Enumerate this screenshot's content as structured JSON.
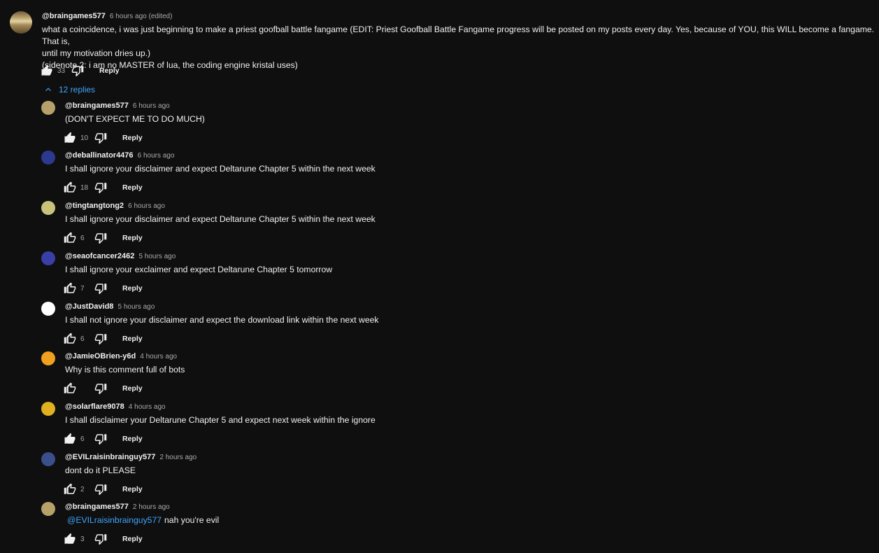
{
  "top_comment": {
    "handle": "@braingames577",
    "time": "6 hours ago (edited)",
    "lines": [
      "what a coincidence, i was just beginning to make a priest goofball battle fangame (EDIT: Priest Goofball Battle Fangame progress will be posted on my posts every day. Yes, because of YOU, this WILL become a fangame. That is,",
      "until my motivation dries up.)",
      "(sidenote 2: i am no MASTER of lua, the coding engine kristal uses)"
    ],
    "likes": "33",
    "reply_label": "Reply"
  },
  "replies_toggle": {
    "label": "12 replies"
  },
  "replies": [
    {
      "handle": "@braingames577",
      "time": "6 hours ago",
      "text": "(DON'T EXPECT ME TO DO MUCH)",
      "likes": "10",
      "reply_label": "Reply",
      "avatar_color": "#b8a06a",
      "liked": true
    },
    {
      "handle": "@deballinator4476",
      "time": "6 hours ago",
      "text": "I shall ignore your disclaimer and expect Deltarune Chapter 5 within the next week",
      "likes": "18",
      "reply_label": "Reply",
      "avatar_color": "#2b3a8f",
      "liked": false
    },
    {
      "handle": "@tingtangtong2",
      "time": "6 hours ago",
      "text": "I shall ignore your disclaimer and expect Deltarune Chapter 5 within the next week",
      "likes": "6",
      "reply_label": "Reply",
      "avatar_color": "#c9c27a",
      "liked": false
    },
    {
      "handle": "@seaofcancer2462",
      "time": "5 hours ago",
      "text": "I shall ignore your exclaimer and expect Deltarune Chapter 5 tomorrow",
      "likes": "7",
      "reply_label": "Reply",
      "avatar_color": "#3a3fa8",
      "liked": false
    },
    {
      "handle": "@JustDavid8",
      "time": "5 hours ago",
      "text": "I shall not ignore your disclaimer and expect the download link within the next week",
      "likes": "6",
      "reply_label": "Reply",
      "avatar_color": "#ffffff",
      "liked": false
    },
    {
      "handle": "@JamieOBrien-y6d",
      "time": "4 hours ago",
      "text": "Why is this comment full of bots",
      "likes": "",
      "reply_label": "Reply",
      "avatar_color": "#f0a020",
      "liked": false
    },
    {
      "handle": "@solarflare9078",
      "time": "4 hours ago",
      "text": "I shall disclaimer your Deltarune Chapter 5 and expect next week within the ignore",
      "likes": "6",
      "reply_label": "Reply",
      "avatar_color": "#e0b020",
      "liked": true
    },
    {
      "handle": "@EVILraisinbrainguy577",
      "time": "2 hours ago",
      "text": "dont do it PLEASE",
      "likes": "2",
      "reply_label": "Reply",
      "avatar_color": "#3b4f8a",
      "liked": false
    },
    {
      "handle": "@braingames577",
      "time": "2 hours ago",
      "mention": "@EVILraisinbrainguy577",
      "text": "nah you're evil",
      "likes": "3",
      "reply_label": "Reply",
      "avatar_color": "#b8a06a",
      "liked": true
    }
  ],
  "icons": {
    "like": "thumb-up-icon",
    "dislike": "thumb-down-icon",
    "toggle": "chevron-up-icon"
  },
  "colors": {
    "background": "#0f0f0f",
    "link": "#3ea6ff",
    "muted": "#aaaaaa"
  }
}
